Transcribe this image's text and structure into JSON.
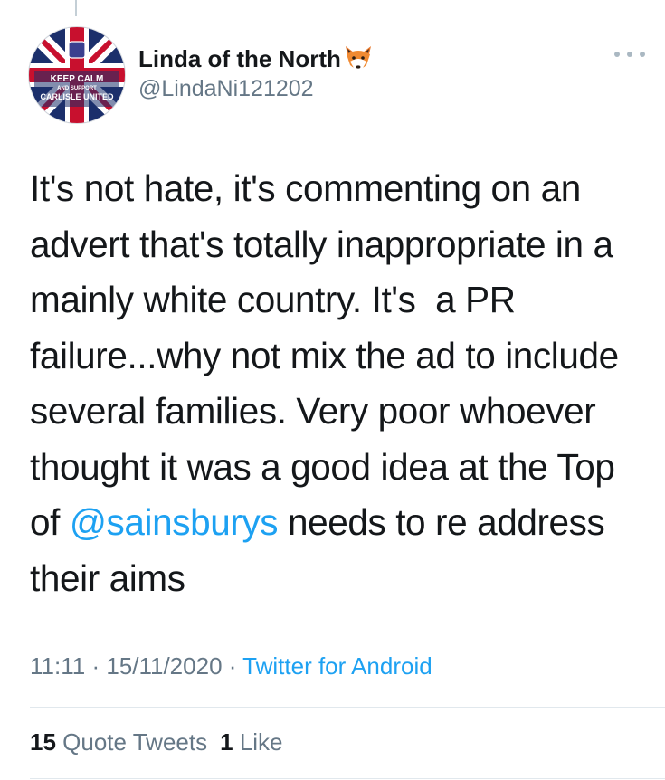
{
  "tweet": {
    "author": {
      "display_name": "Linda of the North",
      "emoji_icon": "fox-face-icon",
      "handle": "@LindaNi121202",
      "avatar": {
        "line1": "KEEP CALM",
        "line2": "AND SUPPORT",
        "line3": "CARLISLE UNITED"
      }
    },
    "text": {
      "part1": "It's not hate, it's commenting on an advert that's totally inappropriate in a mainly white country. It's  a PR failure...why not mix the ad to include several families. Very poor whoever thought it was a good idea at the Top of ",
      "mention": "@sainsburys",
      "part2": " needs to re address their aims"
    },
    "time": "11:11",
    "separator1": " · ",
    "date": "15/11/2020",
    "separator2": " · ",
    "source": "Twitter for Android",
    "stats": {
      "quote_count": "15",
      "quote_label": "Quote Tweets",
      "like_count": "1",
      "like_label": "Like"
    },
    "colors": {
      "link": "#1da1f2",
      "secondary_text": "#657786",
      "primary_text": "#14171a"
    }
  }
}
